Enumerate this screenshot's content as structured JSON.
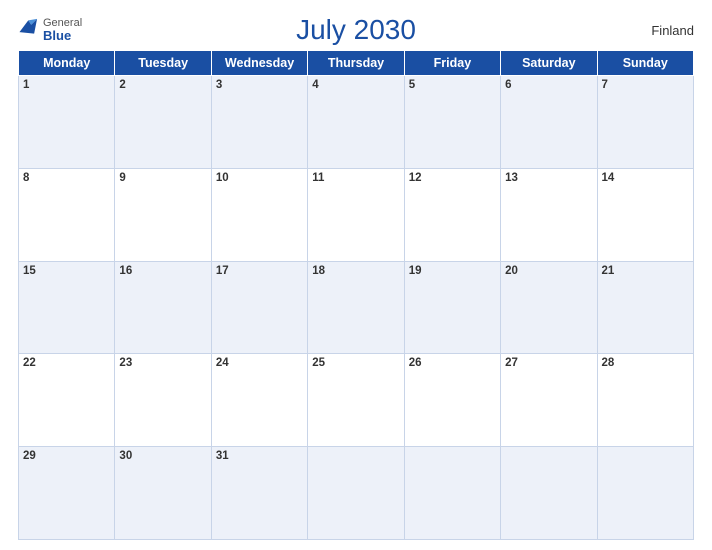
{
  "header": {
    "logo_general": "General",
    "logo_blue": "Blue",
    "title": "July 2030",
    "country": "Finland"
  },
  "days_of_week": [
    "Monday",
    "Tuesday",
    "Wednesday",
    "Thursday",
    "Friday",
    "Saturday",
    "Sunday"
  ],
  "weeks": [
    [
      {
        "date": "1",
        "empty": false
      },
      {
        "date": "2",
        "empty": false
      },
      {
        "date": "3",
        "empty": false
      },
      {
        "date": "4",
        "empty": false
      },
      {
        "date": "5",
        "empty": false
      },
      {
        "date": "6",
        "empty": false
      },
      {
        "date": "7",
        "empty": false
      }
    ],
    [
      {
        "date": "8",
        "empty": false
      },
      {
        "date": "9",
        "empty": false
      },
      {
        "date": "10",
        "empty": false
      },
      {
        "date": "11",
        "empty": false
      },
      {
        "date": "12",
        "empty": false
      },
      {
        "date": "13",
        "empty": false
      },
      {
        "date": "14",
        "empty": false
      }
    ],
    [
      {
        "date": "15",
        "empty": false
      },
      {
        "date": "16",
        "empty": false
      },
      {
        "date": "17",
        "empty": false
      },
      {
        "date": "18",
        "empty": false
      },
      {
        "date": "19",
        "empty": false
      },
      {
        "date": "20",
        "empty": false
      },
      {
        "date": "21",
        "empty": false
      }
    ],
    [
      {
        "date": "22",
        "empty": false
      },
      {
        "date": "23",
        "empty": false
      },
      {
        "date": "24",
        "empty": false
      },
      {
        "date": "25",
        "empty": false
      },
      {
        "date": "26",
        "empty": false
      },
      {
        "date": "27",
        "empty": false
      },
      {
        "date": "28",
        "empty": false
      }
    ],
    [
      {
        "date": "29",
        "empty": false
      },
      {
        "date": "30",
        "empty": false
      },
      {
        "date": "31",
        "empty": false
      },
      {
        "date": "",
        "empty": true
      },
      {
        "date": "",
        "empty": true
      },
      {
        "date": "",
        "empty": true
      },
      {
        "date": "",
        "empty": true
      }
    ]
  ]
}
